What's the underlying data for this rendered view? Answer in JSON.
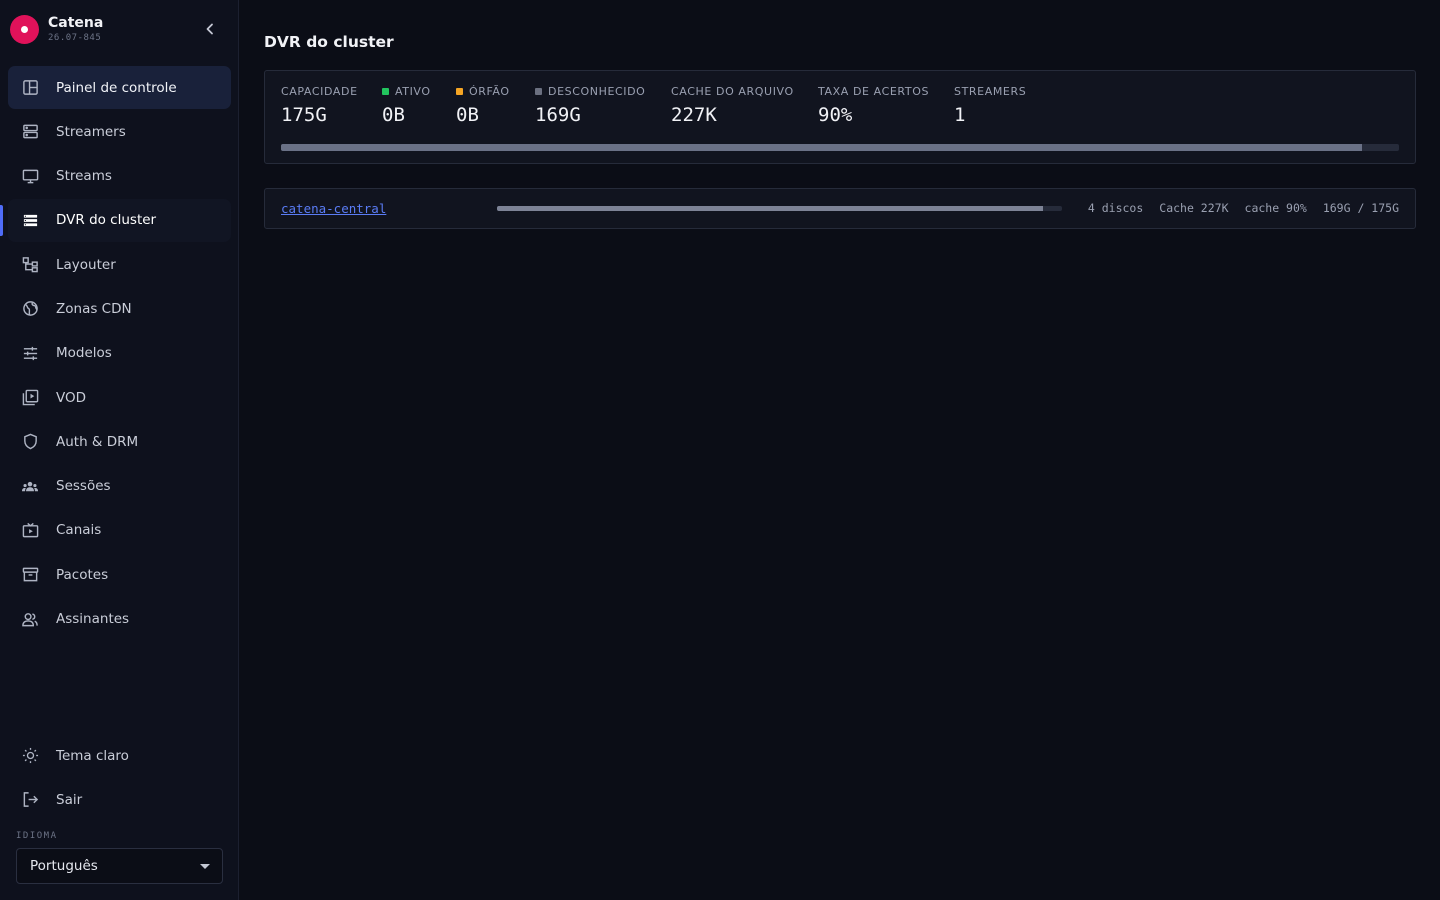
{
  "brand": {
    "name": "Catena",
    "version": "26.07-845",
    "logo_color": "#e0125a"
  },
  "nav": {
    "items": [
      {
        "label": "Painel de controle",
        "icon": "dashboard-icon",
        "state": "selected"
      },
      {
        "label": "Streamers",
        "icon": "server-icon",
        "state": ""
      },
      {
        "label": "Streams",
        "icon": "monitor-icon",
        "state": ""
      },
      {
        "label": "DVR do cluster",
        "icon": "list-icon",
        "state": "current"
      },
      {
        "label": "Layouter",
        "icon": "layout-tree-icon",
        "state": ""
      },
      {
        "label": "Zonas CDN",
        "icon": "globe-icon",
        "state": ""
      },
      {
        "label": "Modelos",
        "icon": "sliders-icon",
        "state": ""
      },
      {
        "label": "VOD",
        "icon": "video-library-icon",
        "state": ""
      },
      {
        "label": "Auth & DRM",
        "icon": "shield-icon",
        "state": ""
      },
      {
        "label": "Sessões",
        "icon": "group-icon",
        "state": ""
      },
      {
        "label": "Canais",
        "icon": "tv-icon",
        "state": ""
      },
      {
        "label": "Pacotes",
        "icon": "archive-icon",
        "state": ""
      },
      {
        "label": "Assinantes",
        "icon": "users-icon",
        "state": ""
      }
    ],
    "bottom": [
      {
        "label": "Tema claro",
        "icon": "sun-icon"
      },
      {
        "label": "Sair",
        "icon": "logout-icon"
      }
    ]
  },
  "language": {
    "label": "IDIOMA",
    "selected": "Português"
  },
  "page": {
    "title": "DVR do cluster"
  },
  "summary": {
    "stats": [
      {
        "label": "CAPACIDADE",
        "value": "175G",
        "dot": ""
      },
      {
        "label": "ATIVO",
        "value": "0B",
        "dot": "#22c55e"
      },
      {
        "label": "ÓRFÃO",
        "value": "0B",
        "dot": "#f5a524"
      },
      {
        "label": "DESCONHECIDO",
        "value": "169G",
        "dot": "#6b7080"
      },
      {
        "label": "CACHE DO ARQUIVO",
        "value": "227K",
        "dot": ""
      },
      {
        "label": "TAXA DE ACERTOS",
        "value": "90%",
        "dot": ""
      },
      {
        "label": "STREAMERS",
        "value": "1",
        "dot": ""
      }
    ],
    "usage_fraction": 0.967
  },
  "servers": [
    {
      "name": "catena-central",
      "usage_fraction": 0.967,
      "disks": "4 discos",
      "cache": "Cache 227K",
      "hit": "cache 90%",
      "usage": "169G / 175G"
    }
  ],
  "colors": {
    "accent": "#4f6cf7",
    "link": "#5a7cf5"
  }
}
